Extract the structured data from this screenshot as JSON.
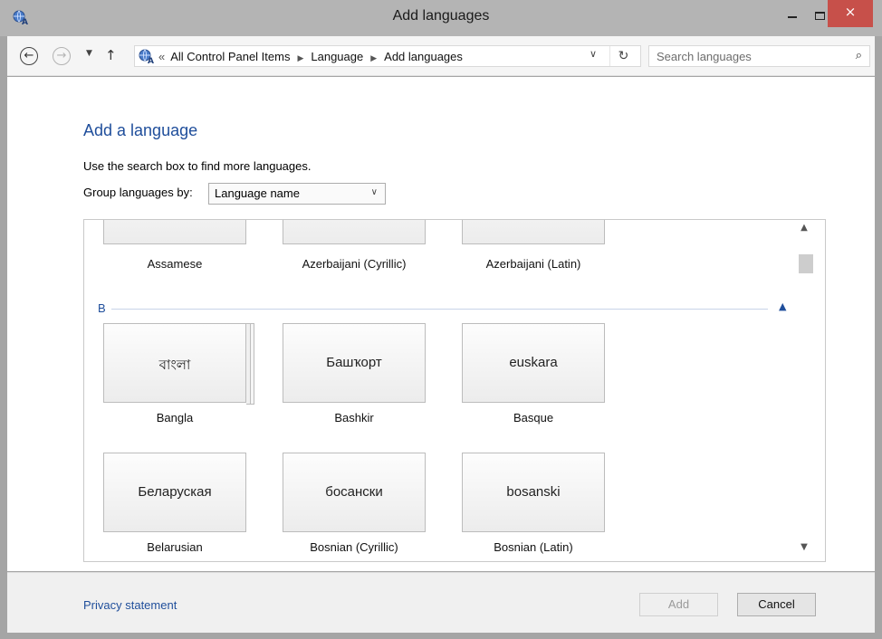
{
  "window": {
    "title": "Add languages",
    "close_glyph": "×"
  },
  "nav": {
    "back_glyph": "←",
    "forward_glyph": "→",
    "recent_glyph": "▼",
    "up_glyph": "↑",
    "path_overflow": "«",
    "breadcrumb": [
      "All Control Panel Items",
      "Language",
      "Add languages"
    ],
    "breadcrumb_sep": "▶",
    "dropdown_glyph": "∨",
    "refresh_glyph": "↻",
    "search_placeholder": "Search languages",
    "search_glyph": "⌕"
  },
  "main": {
    "heading": "Add a language",
    "hint": "Use the search box to find more languages.",
    "group_label": "Group languages by:",
    "group_value": "Language name",
    "group_chevron": "∨"
  },
  "list": {
    "partial_row": [
      "Assamese",
      "Azerbaijani (Cyrillic)",
      "Azerbaijani (Latin)"
    ],
    "section": {
      "letter": "B",
      "collapse_glyph": "▲"
    },
    "languages": [
      {
        "native": "বাংলা",
        "name": "Bangla",
        "stacked": true
      },
      {
        "native": "Башҡорт",
        "name": "Bashkir",
        "stacked": false
      },
      {
        "native": "euskara",
        "name": "Basque",
        "stacked": false
      },
      {
        "native": "Беларуская",
        "name": "Belarusian",
        "stacked": false
      },
      {
        "native": "босански",
        "name": "Bosnian (Cyrillic)",
        "stacked": false
      },
      {
        "native": "bosanski",
        "name": "Bosnian (Latin)",
        "stacked": false
      }
    ],
    "scroll_up_glyph": "▲",
    "scroll_down_glyph": "▼"
  },
  "footer": {
    "privacy_link": "Privacy statement",
    "add_label": "Add",
    "cancel_label": "Cancel"
  },
  "colors": {
    "link_blue": "#1f4e9b",
    "close_red": "#c7504a"
  }
}
